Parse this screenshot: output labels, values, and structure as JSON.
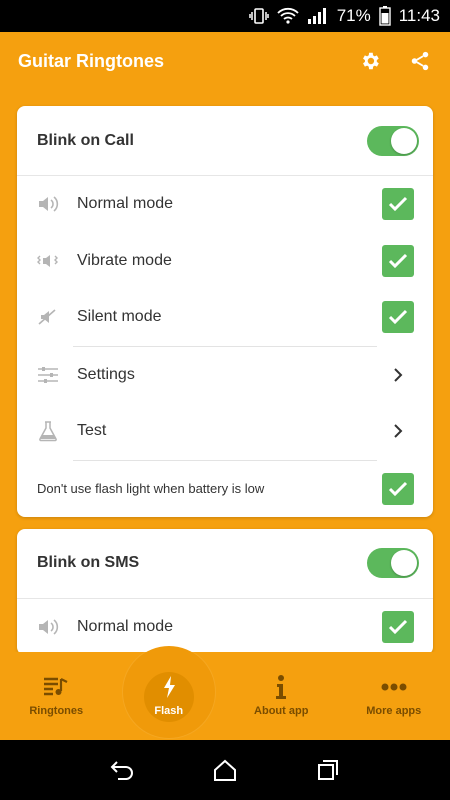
{
  "status_bar": {
    "battery": "71%",
    "time": "11:43"
  },
  "app_bar": {
    "title": "Guitar Ringtones"
  },
  "cards": [
    {
      "title": "Blink on Call",
      "enabled": true,
      "rows": [
        {
          "icon": "speaker-icon",
          "label": "Normal mode",
          "type": "check",
          "checked": true
        },
        {
          "icon": "vibrate-icon",
          "label": "Vibrate mode",
          "type": "check",
          "checked": true
        },
        {
          "icon": "mute-icon",
          "label": "Silent mode",
          "type": "check",
          "checked": true
        },
        {
          "icon": "sliders-icon",
          "label": "Settings",
          "type": "link"
        },
        {
          "icon": "flask-icon",
          "label": "Test",
          "type": "link"
        },
        {
          "label": "Don't use flash light when battery is low",
          "type": "check",
          "checked": true
        }
      ]
    },
    {
      "title": "Blink on SMS",
      "enabled": true,
      "rows": [
        {
          "icon": "speaker-icon",
          "label": "Normal mode",
          "type": "check",
          "checked": true
        }
      ]
    }
  ],
  "bottom_nav": {
    "items": [
      {
        "label": "Ringtones",
        "icon": "music-list-icon"
      },
      {
        "label": "Flash",
        "icon": "lightning-icon",
        "active": true
      },
      {
        "label": "About app",
        "icon": "info-icon"
      },
      {
        "label": "More apps",
        "icon": "more-dots-icon"
      }
    ]
  },
  "colors": {
    "accent": "#f5a00f",
    "check": "#5cb85c",
    "inactive_nav": "#7a4d00"
  }
}
